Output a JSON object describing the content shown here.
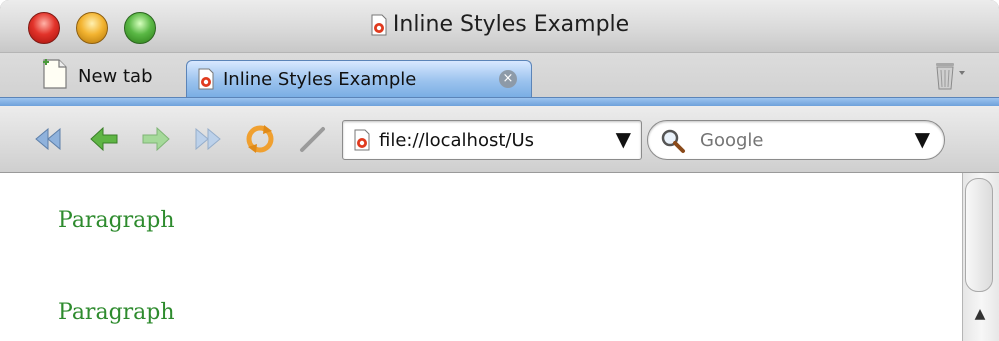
{
  "window": {
    "title": "Inline Styles Example"
  },
  "tabs": {
    "new_tab_label": "New tab",
    "active_tab_label": "Inline Styles Example",
    "close_symbol": "×"
  },
  "toolbar": {
    "url": "file://localhost/Us",
    "url_dropdown_symbol": "▼",
    "search_placeholder": "Google",
    "search_dropdown_symbol": "▼"
  },
  "content": {
    "paragraphs": [
      "Paragraph",
      "Paragraph"
    ],
    "paragraph_color": "#2e8b2e"
  },
  "icons": {
    "page_icon": "document-icon",
    "back_fast": "rewind-icon",
    "back": "back-arrow-icon",
    "forward": "forward-arrow-icon",
    "forward_fast": "fast-forward-icon",
    "reload": "reload-icon",
    "stop": "stop-icon",
    "search": "magnifier-icon",
    "trash": "trash-icon"
  },
  "scrollbar": {
    "up_symbol": "▲"
  }
}
